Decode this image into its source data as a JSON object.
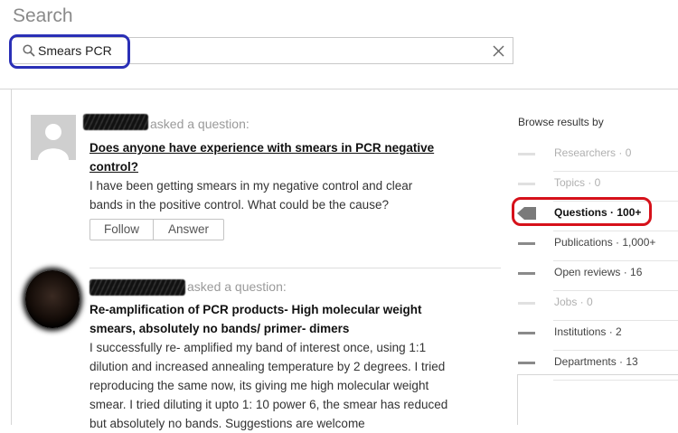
{
  "header": {
    "title": "Search"
  },
  "search": {
    "value": "Smears PCR",
    "placeholder": ""
  },
  "feed": {
    "items": [
      {
        "asked_text": "asked a question:",
        "title": "Does anyone have experience with smears in PCR negative control?",
        "body": "I have been getting smears in my negative control and clear bands in the positive control. What could be the cause?",
        "follow_label": "Follow",
        "answer_label": "Answer"
      },
      {
        "asked_text": "asked a question:",
        "title": "Re-amplification of PCR products- High molecular weight smears, absolutely no bands/ primer- dimers",
        "body": "I successfully re- amplified my band of interest once, using 1:1 dilution and increased annealing temperature by 2 degrees. I tried reproducing the same now, its giving me high molecular weight smear. I tried diluting it upto 1: 10 power 6, the smear has reduced but absolutely no bands. Suggestions are welcome"
      }
    ]
  },
  "sidebar": {
    "title": "Browse results by",
    "items": [
      {
        "label": "Researchers · 0",
        "state": "disabled"
      },
      {
        "label": "Topics · 0",
        "state": "disabled"
      },
      {
        "label": "Questions · 100+",
        "state": "active"
      },
      {
        "label": "Publications · 1,000+",
        "state": "enabled"
      },
      {
        "label": "Open reviews · 16",
        "state": "enabled"
      },
      {
        "label": "Jobs · 0",
        "state": "disabled"
      },
      {
        "label": "Institutions · 2",
        "state": "enabled"
      },
      {
        "label": "Departments · 13",
        "state": "enabled"
      }
    ]
  },
  "colors": {
    "annotation_blue": "#2a2fb6",
    "annotation_red": "#d6111a"
  },
  "icons": [
    "search-icon",
    "clear-icon",
    "active-arrow-icon"
  ]
}
